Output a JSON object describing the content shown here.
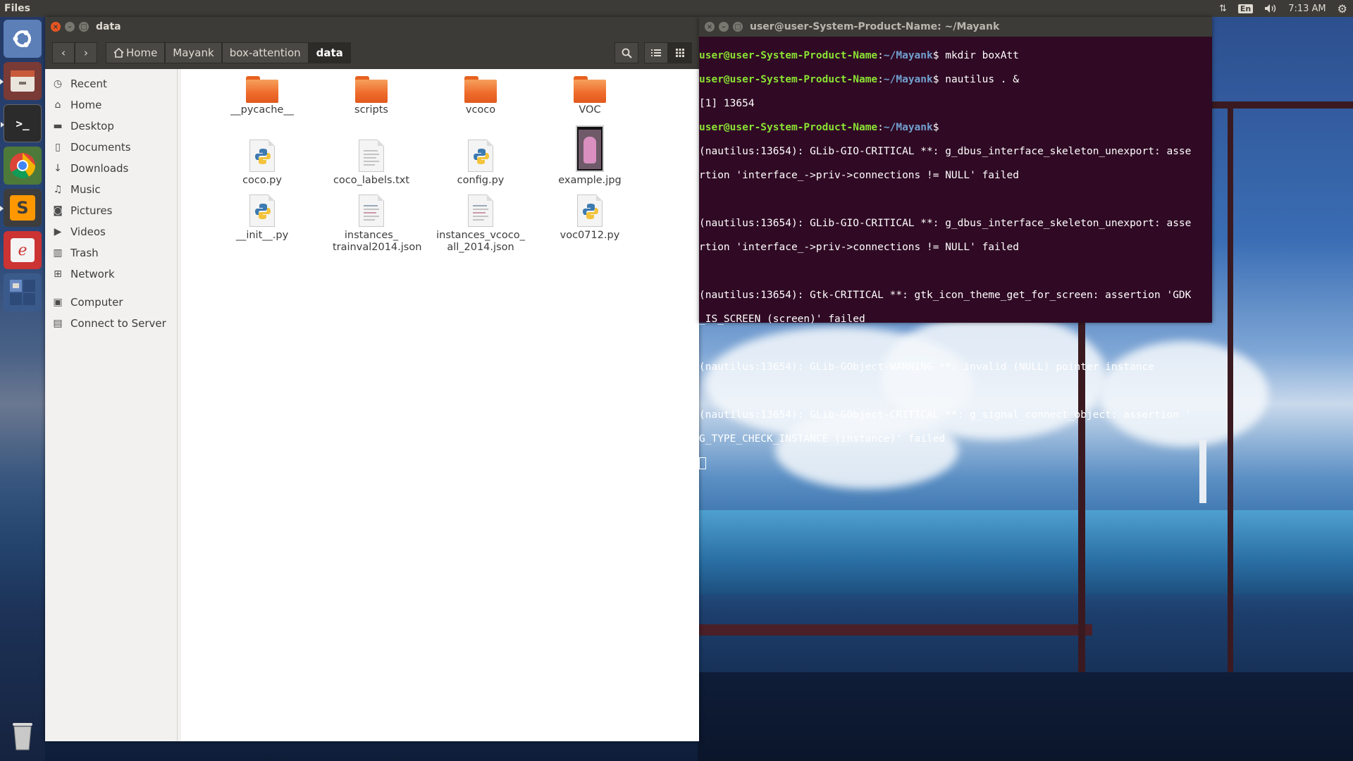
{
  "top_panel": {
    "app_name": "Files",
    "keyboard_layout": "En",
    "time": "7:13 AM"
  },
  "launcher": {
    "items": [
      {
        "name": "dash-home",
        "icon": "ubuntu-logo-icon"
      },
      {
        "name": "files",
        "icon": "file-cabinet-icon"
      },
      {
        "name": "terminal",
        "icon": "terminal-icon"
      },
      {
        "name": "chrome",
        "icon": "chrome-icon"
      },
      {
        "name": "sublime-text",
        "icon": "sublime-icon"
      },
      {
        "name": "document-viewer",
        "icon": "document-viewer-icon"
      },
      {
        "name": "workspace-switcher",
        "icon": "workspace-icon"
      },
      {
        "name": "trash",
        "icon": "trash-icon"
      }
    ]
  },
  "file_manager": {
    "window_title": "data",
    "breadcrumbs": [
      "Home",
      "Mayank",
      "box-attention",
      "data"
    ],
    "sidebar": [
      {
        "label": "Recent",
        "icon": "clock-icon"
      },
      {
        "label": "Home",
        "icon": "home-icon"
      },
      {
        "label": "Desktop",
        "icon": "folder-icon"
      },
      {
        "label": "Documents",
        "icon": "document-icon"
      },
      {
        "label": "Downloads",
        "icon": "download-icon"
      },
      {
        "label": "Music",
        "icon": "music-icon"
      },
      {
        "label": "Pictures",
        "icon": "camera-icon"
      },
      {
        "label": "Videos",
        "icon": "video-icon"
      },
      {
        "label": "Trash",
        "icon": "trash-icon"
      },
      {
        "label": "Network",
        "icon": "network-icon"
      },
      {
        "label": "Computer",
        "icon": "computer-icon"
      },
      {
        "label": "Connect to Server",
        "icon": "server-icon"
      }
    ],
    "files": [
      {
        "name": "__pycache__",
        "type": "folder"
      },
      {
        "name": "scripts",
        "type": "folder"
      },
      {
        "name": "vcoco",
        "type": "folder"
      },
      {
        "name": "VOC",
        "type": "folder"
      },
      {
        "name": "coco.py",
        "type": "python"
      },
      {
        "name": "coco_labels.txt",
        "type": "text"
      },
      {
        "name": "config.py",
        "type": "python"
      },
      {
        "name": "example.jpg",
        "type": "image"
      },
      {
        "name": "__init__.py",
        "type": "python"
      },
      {
        "name": "instances_ trainval2014.json",
        "type": "json"
      },
      {
        "name": "instances_vcoco_ all_2014.json",
        "type": "json"
      },
      {
        "name": "voc0712.py",
        "type": "python"
      }
    ]
  },
  "terminal": {
    "window_title": "user@user-System-Product-Name: ~/Mayank",
    "lines": [
      {
        "prompt": "user@user-System-Product-Name",
        "sep": ":",
        "path": "~/Mayank",
        "cmd": "$ mkdir boxAtt"
      },
      {
        "prompt": "user@user-System-Product-Name",
        "sep": ":",
        "path": "~/Mayank",
        "cmd": "$ nautilus . &"
      },
      {
        "text": "[1] 13654"
      },
      {
        "prompt": "user@user-System-Product-Name",
        "sep": ":",
        "path": "~/Mayank",
        "cmd": "$"
      },
      {
        "text": "(nautilus:13654): GLib-GIO-CRITICAL **: g_dbus_interface_skeleton_unexport: asse"
      },
      {
        "text": "rtion 'interface_->priv->connections != NULL' failed"
      },
      {
        "text": ""
      },
      {
        "text": "(nautilus:13654): GLib-GIO-CRITICAL **: g_dbus_interface_skeleton_unexport: asse"
      },
      {
        "text": "rtion 'interface_->priv->connections != NULL' failed"
      },
      {
        "text": ""
      },
      {
        "text": "(nautilus:13654): Gtk-CRITICAL **: gtk_icon_theme_get_for_screen: assertion 'GDK"
      },
      {
        "text": "_IS_SCREEN (screen)' failed"
      },
      {
        "text": ""
      },
      {
        "text": "(nautilus:13654): GLib-GObject-WARNING **: invalid (NULL) pointer instance"
      },
      {
        "text": ""
      },
      {
        "text": "(nautilus:13654): GLib-GObject-CRITICAL **: g_signal_connect_object: assertion '"
      },
      {
        "text": "G_TYPE_CHECK_INSTANCE (instance)' failed"
      }
    ]
  },
  "colors": {
    "ubuntu_orange": "#e95420",
    "panel_bg": "#3c3b37",
    "terminal_bg": "#300a24",
    "prompt_green": "#8ae234",
    "path_blue": "#729fcf"
  }
}
